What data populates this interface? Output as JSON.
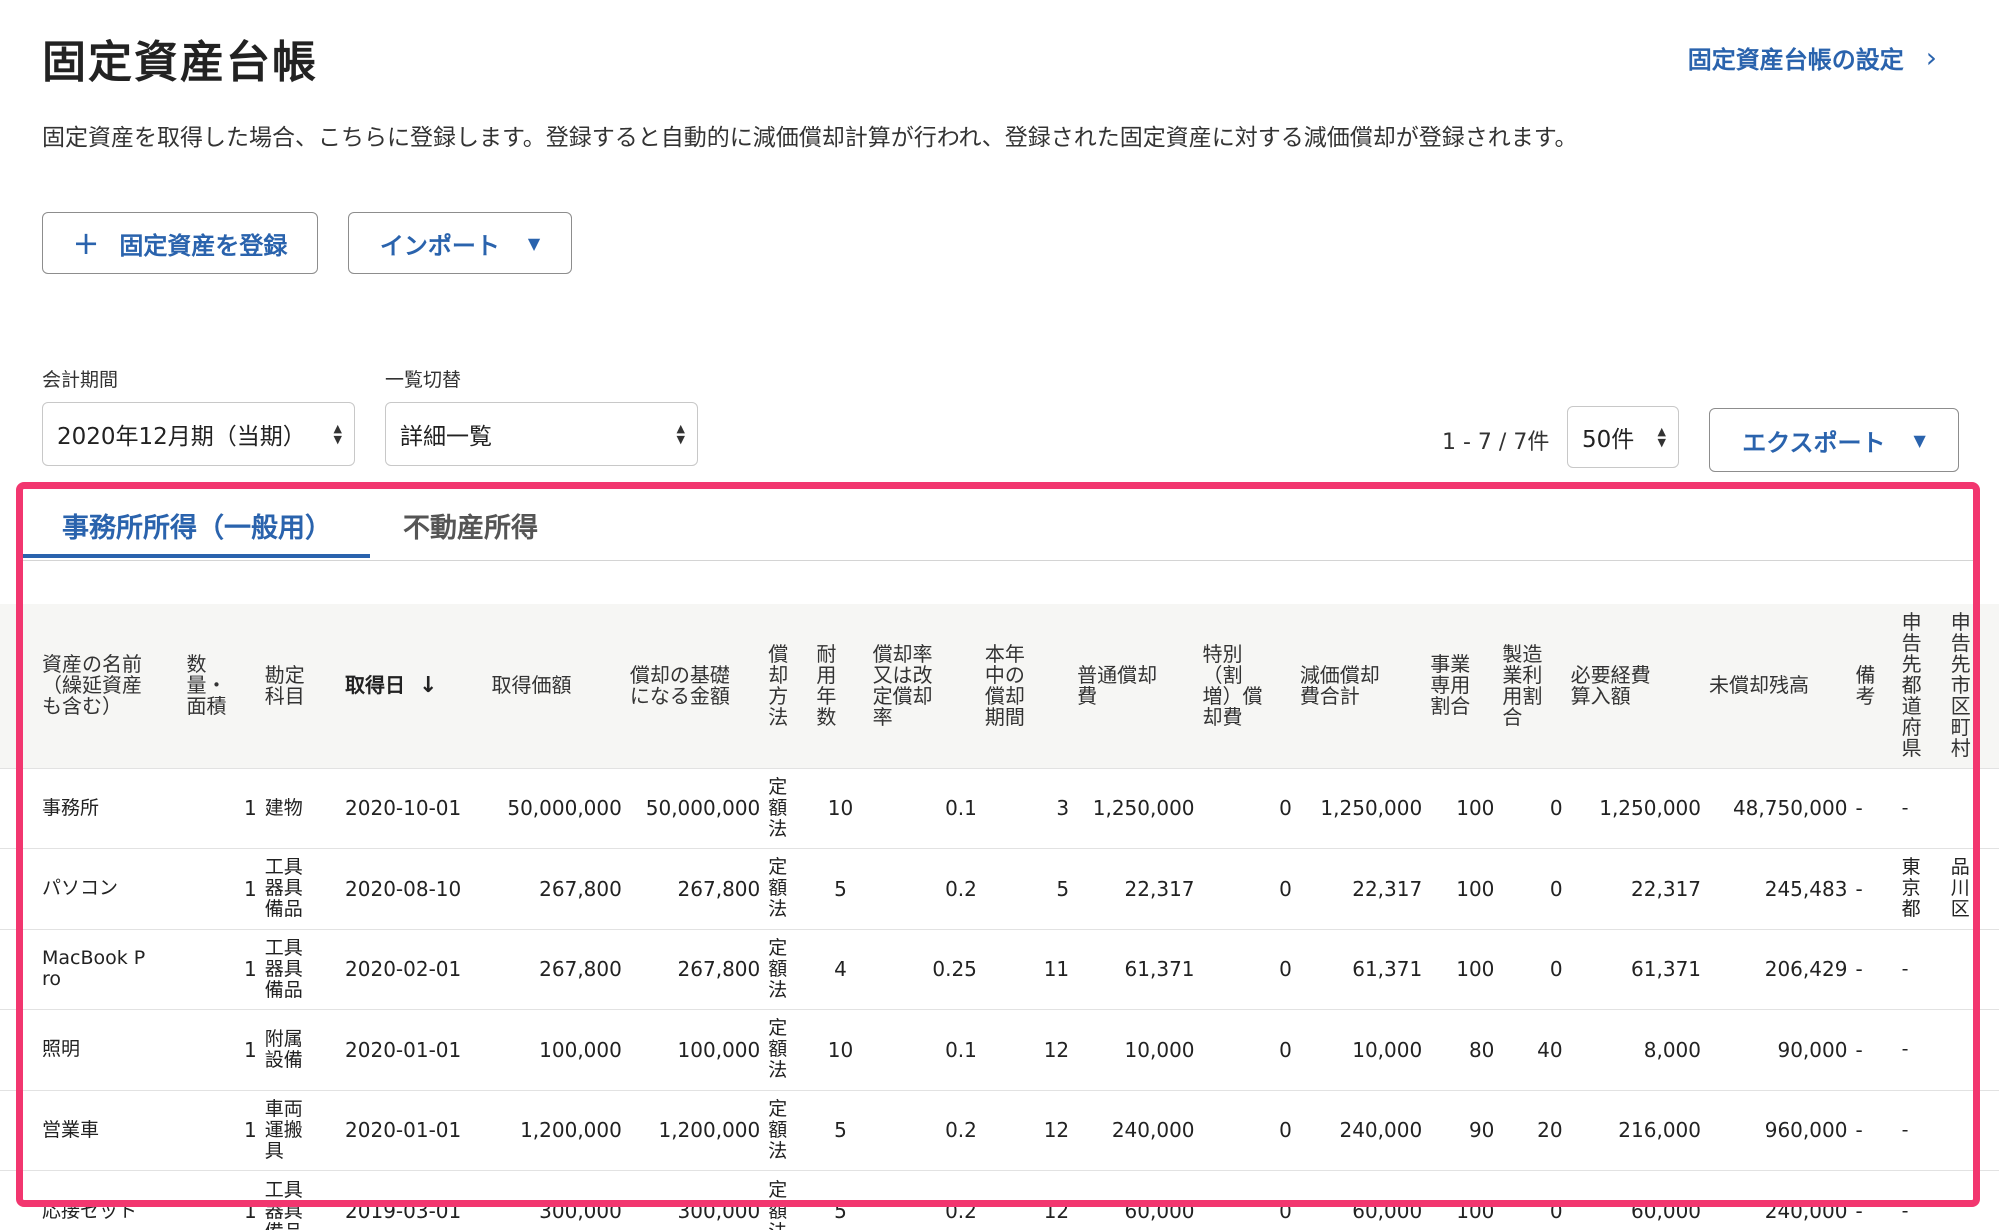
{
  "page": {
    "title": "固定資産台帳",
    "settings_link": "固定資産台帳の設定",
    "description": "固定資産を取得した場合、こちらに登録します。登録すると自動的に減価償却計算が行われ、登録された固定資産に対する減価償却が登録されます。"
  },
  "actions": {
    "register_label": "固定資産を登録",
    "import_label": "インポート",
    "export_label": "エクスポート"
  },
  "filters": {
    "period_label": "会計期間",
    "period_value": "2020年12月期（当期）",
    "view_label": "一覧切替",
    "view_value": "詳細一覧",
    "count_text": "1 - 7 / 7件",
    "per_page_value": "50件"
  },
  "tabs": [
    "事務所所得（一般用）",
    "不動産所得"
  ],
  "table": {
    "headers": [
      "資産の名前\n（繰延資産\nも含む）",
      "数\n量・\n面積",
      "勘定\n科目",
      "取得日",
      "取得価額",
      "償却の基礎\nになる金額",
      "償\n却\n方\n法",
      "耐\n用\n年\n数",
      "償却率\n又は改\n定償却\n率",
      "本年\n中の\n償却\n期間",
      "普通償却\n費",
      "特別\n（割\n増）償\n却費",
      "減価償却\n費合計",
      "事業\n専用\n割合",
      "製造\n業利\n用割\n合",
      "必要経費\n算入額",
      "未償却残高",
      "備\n考",
      "申\n告\n先\n都\n道\n府\n県",
      "申\n告\n先\n市\n区\n町\n村"
    ],
    "rows": [
      [
        "事務所",
        "1",
        "建物",
        "2020-10-01",
        "50,000,000",
        "50,000,000",
        "定\n額\n法",
        "10",
        "0.1",
        "3",
        "1,250,000",
        "0",
        "1,250,000",
        "100",
        "0",
        "1,250,000",
        "48,750,000",
        "-",
        "-",
        ""
      ],
      [
        "パソコン",
        "1",
        "工具\n器具\n備品",
        "2020-08-10",
        "267,800",
        "267,800",
        "定\n額\n法",
        "5",
        "0.2",
        "5",
        "22,317",
        "0",
        "22,317",
        "100",
        "0",
        "22,317",
        "245,483",
        "-",
        "東\n京\n都",
        "品\n川\n区"
      ],
      [
        "MacBook P\nro",
        "1",
        "工具\n器具\n備品",
        "2020-02-01",
        "267,800",
        "267,800",
        "定\n額\n法",
        "4",
        "0.25",
        "11",
        "61,371",
        "0",
        "61,371",
        "100",
        "0",
        "61,371",
        "206,429",
        "-",
        "-",
        ""
      ],
      [
        "照明",
        "1",
        "附属\n設備",
        "2020-01-01",
        "100,000",
        "100,000",
        "定\n額\n法",
        "10",
        "0.1",
        "12",
        "10,000",
        "0",
        "10,000",
        "80",
        "40",
        "8,000",
        "90,000",
        "-",
        "-",
        ""
      ],
      [
        "営業車",
        "1",
        "車両\n運搬\n具",
        "2020-01-01",
        "1,200,000",
        "1,200,000",
        "定\n額\n法",
        "5",
        "0.2",
        "12",
        "240,000",
        "0",
        "240,000",
        "90",
        "20",
        "216,000",
        "960,000",
        "-",
        "-",
        ""
      ],
      [
        "応接セット",
        "1",
        "工具\n器具\n備品",
        "2019-03-01",
        "300,000",
        "300,000",
        "定\n額\n法",
        "5",
        "0.2",
        "12",
        "60,000",
        "0",
        "60,000",
        "100",
        "0",
        "60,000",
        "240,000",
        "-",
        "-",
        ""
      ]
    ]
  },
  "colors": {
    "accent": "#2a63ad",
    "highlight_frame": "#f2366f",
    "header_bg": "#f6f6f4"
  }
}
